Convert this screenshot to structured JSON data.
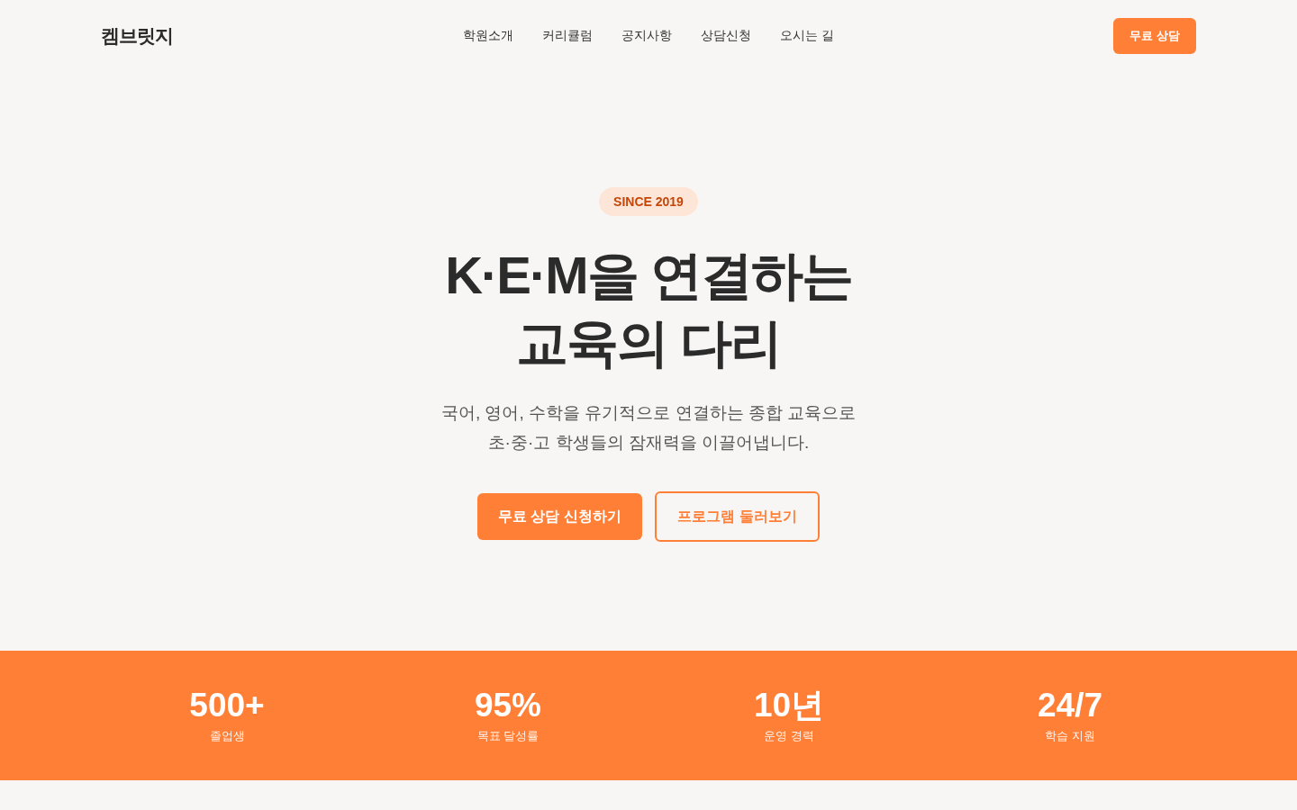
{
  "header": {
    "logo": "켐브릿지",
    "nav": [
      {
        "label": "학원소개"
      },
      {
        "label": "커리큘럼"
      },
      {
        "label": "공지사항"
      },
      {
        "label": "상담신청"
      },
      {
        "label": "오시는 길"
      }
    ],
    "cta": "무료 상담"
  },
  "hero": {
    "badge": "SINCE 2019",
    "title_lines": [
      "K·E·M을 연결하는",
      "교육의 다리"
    ],
    "subtitle_lines": [
      "국어, 영어, 수학을 유기적으로 연결하는 종합 교육으로",
      "초·중·고 학생들의 잠재력을 이끌어냅니다."
    ],
    "buttons": [
      {
        "label": "무료 상담 신청하기",
        "kind": "primary"
      },
      {
        "label": "프로그램 둘러보기",
        "kind": "outline"
      }
    ]
  },
  "stats": [
    {
      "value": "500+",
      "label": "졸업생"
    },
    {
      "value": "95%",
      "label": "목표 달성률"
    },
    {
      "value": "10년",
      "label": "운영 경력"
    },
    {
      "value": "24/7",
      "label": "학습 지원"
    }
  ]
}
